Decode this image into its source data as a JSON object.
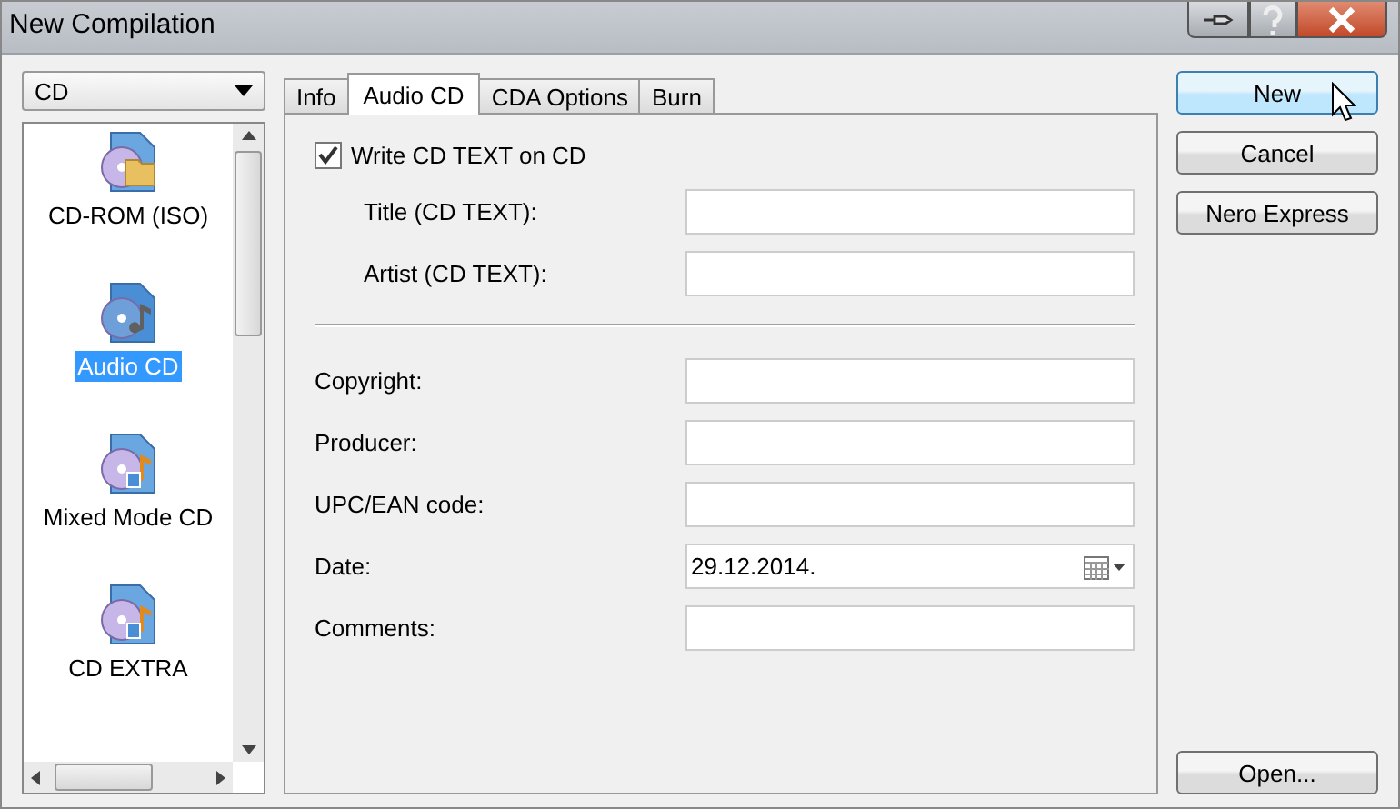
{
  "window": {
    "title": "New Compilation"
  },
  "media_dropdown": {
    "value": "CD"
  },
  "compilation_types": [
    {
      "label": "CD-ROM (ISO)",
      "kind": "folder",
      "selected": false
    },
    {
      "label": "Audio CD",
      "kind": "audio",
      "selected": true
    },
    {
      "label": "Mixed Mode CD",
      "kind": "mixed",
      "selected": false
    },
    {
      "label": "CD EXTRA",
      "kind": "extra",
      "selected": false
    }
  ],
  "tabs": [
    {
      "label": "Info",
      "selected": false
    },
    {
      "label": "Audio CD",
      "selected": true
    },
    {
      "label": "CDA Options",
      "selected": false
    },
    {
      "label": "Burn",
      "selected": false
    }
  ],
  "write_cd_text": {
    "label": "Write CD TEXT on CD",
    "checked": true
  },
  "cd_text_fields": [
    {
      "label": "Title (CD TEXT):"
    },
    {
      "label": "Artist (CD TEXT):"
    }
  ],
  "fields": [
    {
      "label": "Copyright:",
      "kind": "text"
    },
    {
      "label": "Producer:",
      "kind": "text"
    },
    {
      "label": "UPC/EAN code:",
      "kind": "text"
    },
    {
      "label": "Date:",
      "kind": "date",
      "value": "29.12.2014."
    },
    {
      "label": "Comments:",
      "kind": "text"
    }
  ],
  "buttons": [
    {
      "label": "New",
      "kind": "default"
    },
    {
      "label": "Cancel",
      "kind": "normal"
    },
    {
      "label": "Nero Express",
      "kind": "normal"
    }
  ],
  "open_button": {
    "label": "Open..."
  }
}
